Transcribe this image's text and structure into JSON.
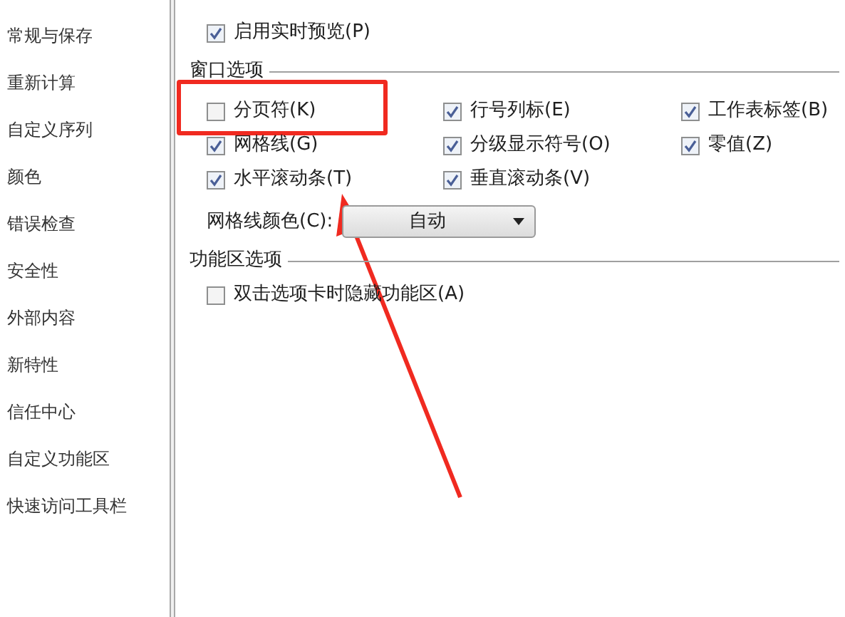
{
  "sidebar": {
    "items": [
      {
        "label": "常规与保存",
        "selected": false
      },
      {
        "label": "重新计算",
        "selected": false
      },
      {
        "label": "自定义序列",
        "selected": false
      },
      {
        "label": "颜色",
        "selected": false
      },
      {
        "label": "错误检查",
        "selected": false
      },
      {
        "label": "安全性",
        "selected": false
      },
      {
        "label": "外部内容",
        "selected": false
      },
      {
        "label": "新特性",
        "selected": false
      },
      {
        "label": "信任中心",
        "selected": false
      },
      {
        "label": "自定义功能区",
        "selected": false
      },
      {
        "label": "快速访问工具栏",
        "selected": false
      }
    ]
  },
  "top_options": [
    {
      "label": "启用实时预览(P)",
      "checked": true
    }
  ],
  "window_options": {
    "title": "窗口选项",
    "columns": [
      [
        {
          "label": "分页符(K)",
          "checked": false
        },
        {
          "label": "网格线(G)",
          "checked": true
        },
        {
          "label": "水平滚动条(T)",
          "checked": true
        }
      ],
      [
        {
          "label": "行号列标(E)",
          "checked": true
        },
        {
          "label": "分级显示符号(O)",
          "checked": true
        },
        {
          "label": "垂直滚动条(V)",
          "checked": true
        }
      ],
      [
        {
          "label": "工作表标签(B)",
          "checked": true
        },
        {
          "label": "零值(Z)",
          "checked": true
        }
      ]
    ],
    "gridline_color": {
      "label": "网格线颜色(C):",
      "value": "自动"
    }
  },
  "ribbon_options": {
    "title": "功能区选项",
    "options": [
      {
        "label": "双击选项卡时隐藏功能区(A)",
        "checked": false
      }
    ]
  }
}
